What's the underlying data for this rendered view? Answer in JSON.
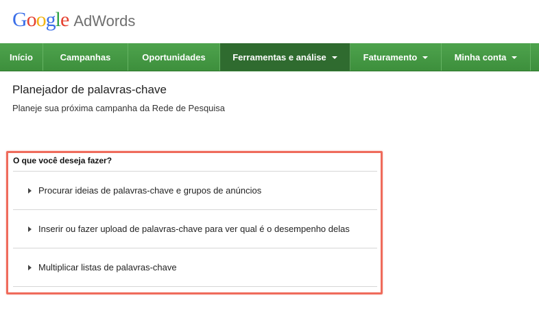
{
  "header": {
    "brand": {
      "letters": [
        {
          "ch": "G",
          "color": "#3a6ee8"
        },
        {
          "ch": "o",
          "color": "#e5402f"
        },
        {
          "ch": "o",
          "color": "#f2b313"
        },
        {
          "ch": "g",
          "color": "#3a6ee8"
        },
        {
          "ch": "l",
          "color": "#2fa245"
        },
        {
          "ch": "e",
          "color": "#e5402f"
        }
      ],
      "product": "AdWords"
    }
  },
  "nav": {
    "items": [
      {
        "label": "Início",
        "has_dropdown": false,
        "active": false
      },
      {
        "label": "Campanhas",
        "has_dropdown": false,
        "active": false
      },
      {
        "label": "Oportunidades",
        "has_dropdown": false,
        "active": false
      },
      {
        "label": "Ferramentas e análise",
        "has_dropdown": true,
        "active": true
      },
      {
        "label": "Faturamento",
        "has_dropdown": true,
        "active": false
      },
      {
        "label": "Minha conta",
        "has_dropdown": true,
        "active": false
      }
    ]
  },
  "page": {
    "title": "Planejador de palavras-chave",
    "subtitle": "Planeje sua próxima campanha da Rede de Pesquisa"
  },
  "panel": {
    "heading": "O que você deseja fazer?",
    "options": [
      {
        "label": "Procurar ideias de palavras-chave e grupos de anúncios"
      },
      {
        "label": "Inserir ou fazer upload de palavras-chave para ver qual é o desempenho delas"
      },
      {
        "label": "Multiplicar listas de palavras-chave"
      }
    ]
  },
  "colors": {
    "nav_green": "#4ea34d",
    "nav_active": "#2f6b2f",
    "highlight_border": "#ef6b5b"
  }
}
